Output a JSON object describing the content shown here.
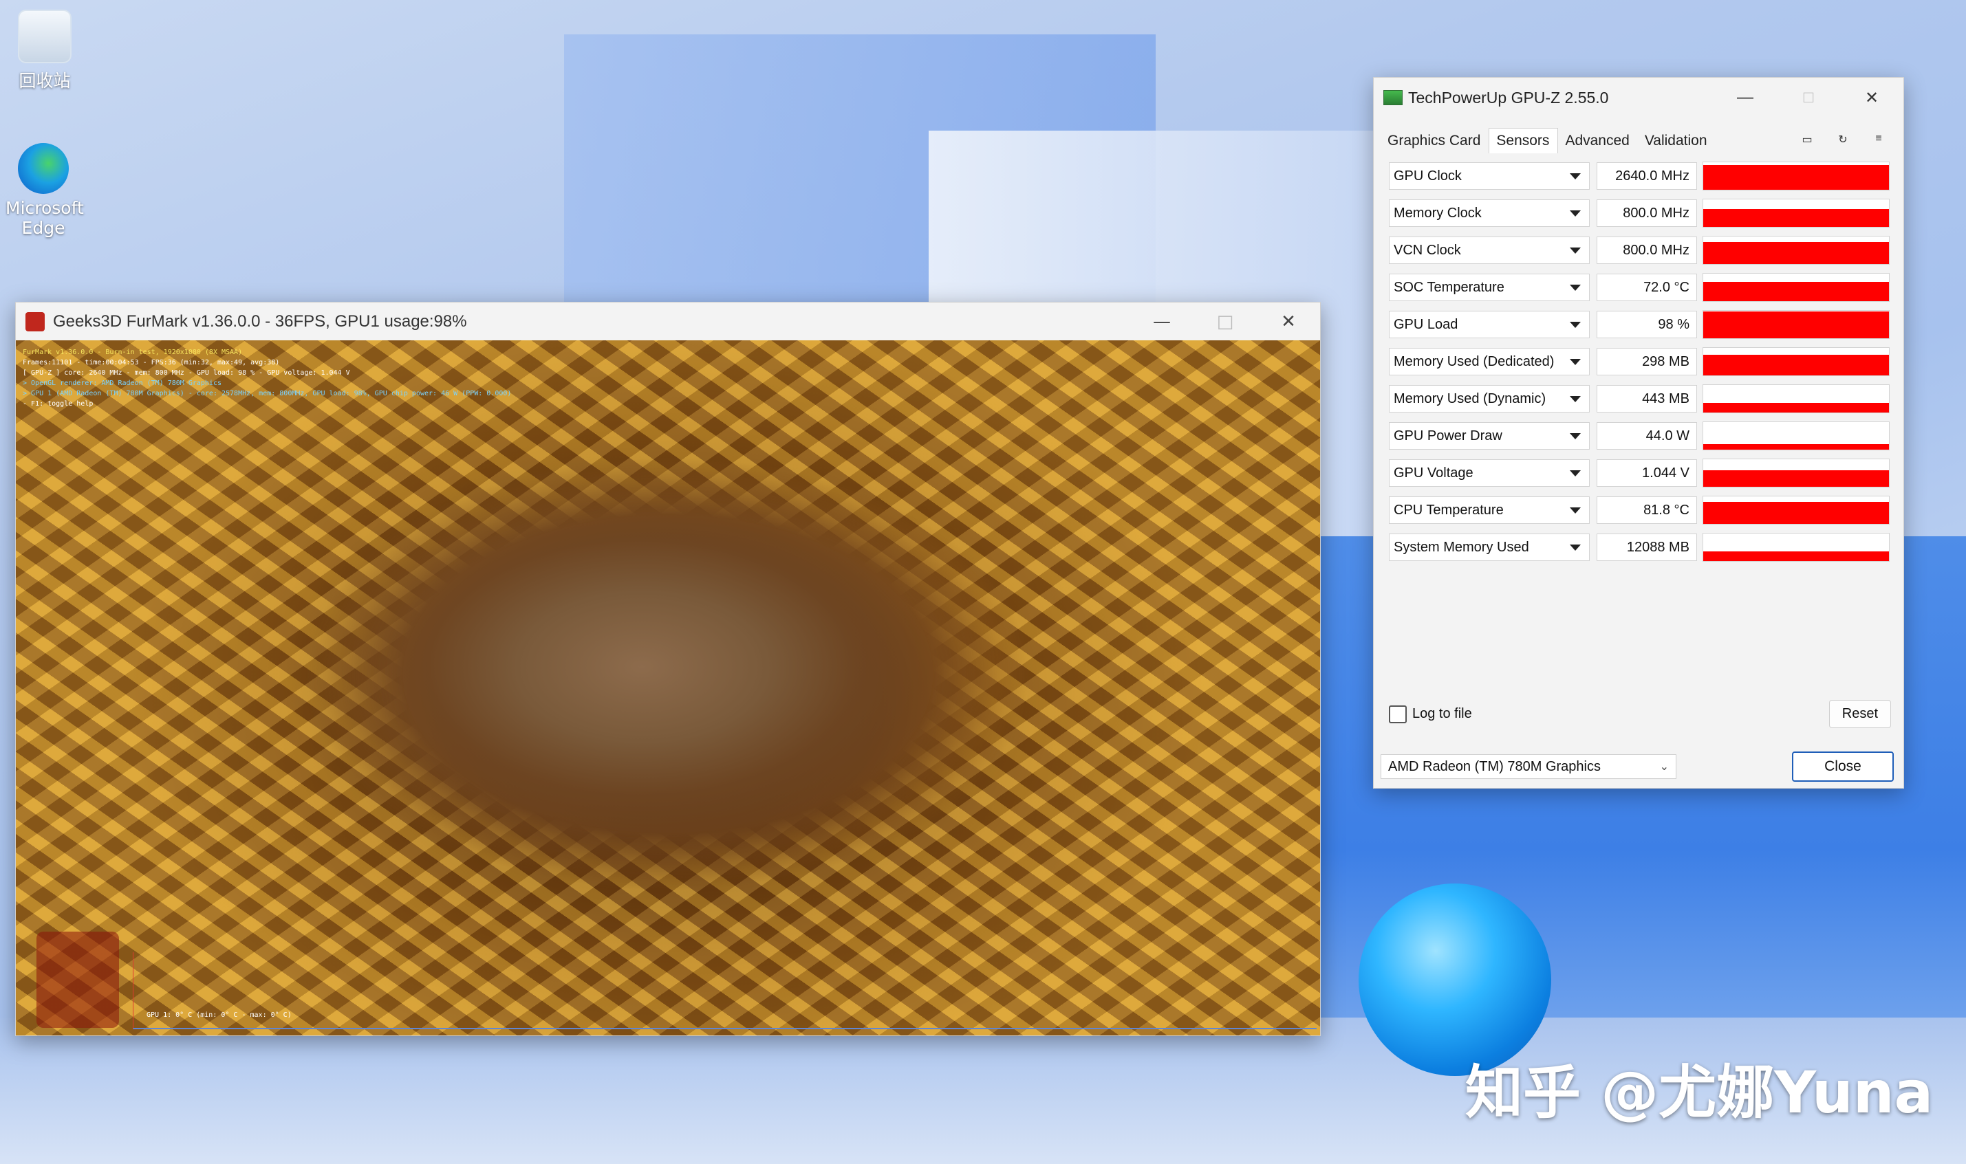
{
  "desktop": {
    "icons": [
      {
        "label": "回收站"
      },
      {
        "label": "Microsoft Edge"
      }
    ],
    "watermark": "知乎 @尤娜Yuna"
  },
  "furmark": {
    "title": "Geeks3D FurMark v1.36.0.0 - 36FPS, GPU1 usage:98%",
    "controls": {
      "minimize": "—",
      "maximize": "□",
      "close": "✕"
    },
    "osd": {
      "line1": "FurMark v1.36.0.0 - Burn-in test, 1920x1080 (8X MSAA)",
      "line2": "Frames:11101 - time:00:04:53 - FPS:36 (min:32, max:49, avg:38)",
      "line3": "[ GPU-Z ] core: 2640 MHz - mem: 800 MHz - GPU load: 98 % - GPU voltage: 1.044 V",
      "line4": "> OpenGL renderer: AMD Radeon (TM) 780M Graphics",
      "line5": "> GPU 1 (AMD Radeon (TM) 780M Graphics) - core: 2578MHz, mem: 800MHz, GPU load: 98%, GPU chip power: 46 W (PPW: 0.000)",
      "line6": "- F1: toggle help"
    },
    "graph_label": "GPU 1: 0° C (min: 0° C - max: 0° C)"
  },
  "gpuz": {
    "title": "TechPowerUp GPU-Z 2.55.0",
    "controls": {
      "minimize": "—",
      "maximize": "□",
      "close": "✕"
    },
    "tabs": [
      "Graphics Card",
      "Sensors",
      "Advanced",
      "Validation"
    ],
    "active_tab": "Sensors",
    "tool_icons": [
      "camera-icon",
      "refresh-icon",
      "menu-icon"
    ],
    "sensors": [
      {
        "name": "GPU Clock",
        "value": "2640.0 MHz",
        "graph_level": 0.9
      },
      {
        "name": "Memory Clock",
        "value": "800.0 MHz",
        "graph_level": 0.65
      },
      {
        "name": "VCN Clock",
        "value": "800.0 MHz",
        "graph_level": 0.8
      },
      {
        "name": "SOC Temperature",
        "value": "72.0 °C",
        "graph_level": 0.7
      },
      {
        "name": "GPU Load",
        "value": "98 %",
        "graph_level": 0.98
      },
      {
        "name": "Memory Used (Dedicated)",
        "value": "298 MB",
        "graph_level": 0.75
      },
      {
        "name": "Memory Used (Dynamic)",
        "value": "443 MB",
        "graph_level": 0.35
      },
      {
        "name": "GPU Power Draw",
        "value": "44.0 W",
        "graph_level": 0.2
      },
      {
        "name": "GPU Voltage",
        "value": "1.044 V",
        "graph_level": 0.6
      },
      {
        "name": "CPU Temperature",
        "value": "81.8 °C",
        "graph_level": 0.8
      },
      {
        "name": "System Memory Used",
        "value": "12088 MB",
        "graph_level": 0.35
      }
    ],
    "log_to_file": "Log to file",
    "reset": "Reset",
    "device": "AMD Radeon (TM) 780M Graphics",
    "close": "Close",
    "colors": {
      "graph": "#ff0000"
    }
  }
}
